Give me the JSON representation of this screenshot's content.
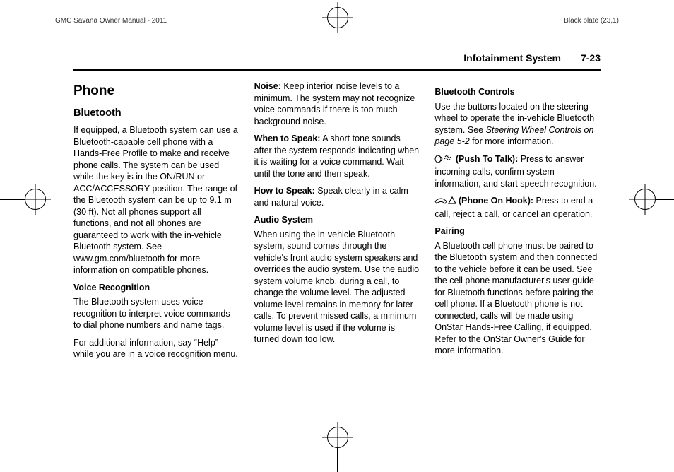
{
  "print": {
    "left": "GMC Savana Owner Manual - 2011",
    "right": "Black plate (23,1)"
  },
  "header": {
    "section": "Infotainment System",
    "page": "7-23"
  },
  "col1": {
    "h1": "Phone",
    "h2": "Bluetooth",
    "p1": "If equipped, a Bluetooth system can use a Bluetooth-capable cell phone with a Hands-Free Profile to make and receive phone calls. The system can be used while the key is in the ON/RUN or ACC/ACCESSORY position. The range of the Bluetooth system can be up to 9.1 m (30 ft). Not all phones support all functions, and not all phones are guaranteed to work with the in-vehicle Bluetooth system. See www.gm.com/bluetooth for more information on compatible phones.",
    "h3a": "Voice Recognition",
    "p2": "The Bluetooth system uses voice recognition to interpret voice commands to dial phone numbers and name tags.",
    "p3": "For additional information, say “Help” while you are in a voice recognition menu."
  },
  "col2": {
    "noise_lead": "Noise:",
    "noise_body": "  Keep interior noise levels to a minimum. The system may not recognize voice commands if there is too much background noise.",
    "when_lead": "When to Speak:",
    "when_body": "  A short tone sounds after the system responds indicating when it is waiting for a voice command. Wait until the tone and then speak.",
    "how_lead": "How to Speak:",
    "how_body": "  Speak clearly in a calm and natural voice.",
    "h3a": "Audio System",
    "p1": "When using the in-vehicle Bluetooth system, sound comes through the vehicle's front audio system speakers and overrides the audio system. Use the audio system volume knob, during a call, to change the volume level. The adjusted volume level remains in memory for later calls. To prevent missed calls, a minimum volume level is used if the volume is turned down too low."
  },
  "col3": {
    "h3a": "Bluetooth Controls",
    "p1a": "Use the buttons located on the steering wheel to operate the in-vehicle Bluetooth system. See ",
    "p1b_ital": "Steering Wheel Controls on page 5-2",
    "p1c": " for more information.",
    "ptt_lead": " (Push To Talk):",
    "ptt_body": "  Press to answer incoming calls, confirm system information, and start speech recognition.",
    "hook_lead": " (Phone On Hook):",
    "hook_body": "  Press to end a call, reject a call, or cancel an operation.",
    "h3b": "Pairing",
    "p2": "A Bluetooth cell phone must be paired to the Bluetooth system and then connected to the vehicle before it can be used. See the cell phone manufacturer's user guide for Bluetooth functions before pairing the cell phone. If a Bluetooth phone is not connected, calls will be made using OnStar Hands-Free Calling, if equipped. Refer to the OnStar Owner's Guide for more information."
  }
}
